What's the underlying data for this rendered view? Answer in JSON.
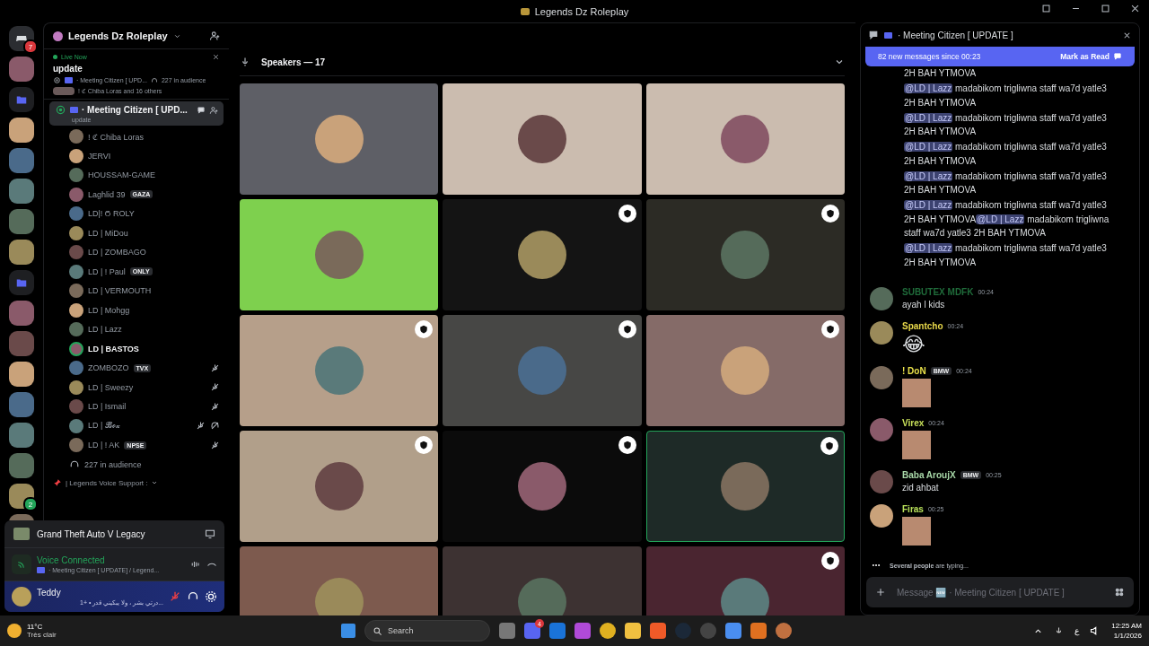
{
  "title_bar": {
    "title": "Legends Dz Roleplay"
  },
  "server_rail": [
    {
      "kind": "home",
      "badge": "7"
    },
    {
      "kind": "server"
    },
    {
      "kind": "folder"
    },
    {
      "kind": "server"
    },
    {
      "kind": "server"
    },
    {
      "kind": "server"
    },
    {
      "kind": "server"
    },
    {
      "kind": "server"
    },
    {
      "kind": "folder"
    },
    {
      "kind": "server"
    },
    {
      "kind": "server"
    },
    {
      "kind": "server"
    },
    {
      "kind": "server"
    },
    {
      "kind": "server"
    },
    {
      "kind": "server"
    },
    {
      "kind": "server",
      "badge": "2"
    },
    {
      "kind": "server"
    }
  ],
  "sidebar": {
    "server_name": "Legends Dz Roleplay",
    "live_card": {
      "status": "Live Now",
      "topic": "update",
      "channel": "· Meeting Citizen [ UPD...",
      "audience": "227 in audience",
      "speakers": "! ℭ Chiba Loras and 16 others"
    },
    "active_channel": {
      "name": "· Meeting Citizen [ UPD...",
      "topic": "update",
      "selected": true
    },
    "members": [
      {
        "name": "! ℭ Chiba Loras",
        "muted": false,
        "deafened": false,
        "speaking": false
      },
      {
        "name": "JERVI",
        "muted": false,
        "deafened": false,
        "speaking": false
      },
      {
        "name": "HOUSSAM-GAME",
        "muted": false,
        "deafened": false,
        "speaking": false
      },
      {
        "name": "Laghlid 39",
        "tag": "GAZA",
        "muted": false,
        "deafened": false,
        "speaking": false
      },
      {
        "name": "LD|! Ϭ ROLY",
        "muted": false,
        "deafened": false,
        "speaking": false
      },
      {
        "name": "LD | MiDou",
        "muted": false,
        "deafened": false,
        "speaking": false
      },
      {
        "name": "LD | ZOMBAGO",
        "muted": false,
        "deafened": false,
        "speaking": false
      },
      {
        "name": "LD | ! Paul",
        "tag": "ONLY",
        "muted": false,
        "deafened": false,
        "speaking": false
      },
      {
        "name": "LD | VERMOUTH",
        "muted": false,
        "deafened": false,
        "speaking": false
      },
      {
        "name": "LD | Mohgg",
        "muted": false,
        "deafened": false,
        "speaking": false
      },
      {
        "name": "LD | Lazz",
        "muted": false,
        "deafened": false,
        "speaking": false
      },
      {
        "name": "LD | BASTOS",
        "muted": false,
        "deafened": false,
        "speaking": true
      },
      {
        "name": "ZOMBOZO",
        "tag": "TVX",
        "muted": true,
        "deafened": false,
        "speaking": false
      },
      {
        "name": "LD |  Sweezy",
        "muted": true,
        "deafened": false,
        "speaking": false
      },
      {
        "name": "LD | Ismail",
        "muted": true,
        "deafened": false,
        "speaking": false
      },
      {
        "name": "LD | 𝓑𝓸𝔁",
        "muted": true,
        "deafened": true,
        "speaking": false
      },
      {
        "name": "LD | ! AK",
        "tag": "NPSE",
        "muted": true,
        "deafened": false,
        "speaking": false
      }
    ],
    "audience": "227 in audience",
    "category": "| Legends Voice Support :",
    "activity": "Grand Theft Auto V Legacy",
    "voice": {
      "status": "Voice Connected",
      "channel": "· Meeting Citizen [ UPDATE] / Legend..."
    },
    "user": {
      "name": "Teddy",
      "status": "...درتي بشر ، ولا يبكيني قدر • +1",
      "mic_muted": true
    }
  },
  "stage": {
    "heading": "Speakers — 17",
    "tiles": [
      {
        "color": "#5e5f66",
        "badge": false,
        "speaking": false
      },
      {
        "color": "#cbbcaf",
        "badge": false,
        "speaking": false
      },
      {
        "color": "#cbbcaf",
        "badge": false,
        "speaking": false
      },
      {
        "color": "#7ed04e",
        "badge": false,
        "speaking": false
      },
      {
        "color": "#141414",
        "badge": true,
        "speaking": false
      },
      {
        "color": "#2c2b25",
        "badge": true,
        "speaking": false
      },
      {
        "color": "#b69f8a",
        "badge": true,
        "speaking": false
      },
      {
        "color": "#474745",
        "badge": true,
        "speaking": false
      },
      {
        "color": "#856b68",
        "badge": true,
        "speaking": false
      },
      {
        "color": "#b19f8a",
        "badge": true,
        "speaking": false
      },
      {
        "color": "#0b0b0b",
        "badge": true,
        "speaking": false
      },
      {
        "color": "#1e2a27",
        "badge": true,
        "speaking": true
      },
      {
        "color": "#7d5a4e",
        "badge": false,
        "speaking": false
      },
      {
        "color": "#3d3232",
        "badge": false,
        "speaking": false
      },
      {
        "color": "#4a2530",
        "badge": true,
        "speaking": false
      }
    ]
  },
  "chat": {
    "title": "· Meeting Citizen [ UPDATE ]",
    "banner": {
      "text": "82 new messages since 00:23",
      "action": "Mark as Read"
    },
    "continued": [
      {
        "parts": [
          {
            "kind": "text",
            "text": "2H BAH YTMOVA"
          }
        ]
      },
      {
        "parts": [
          {
            "kind": "mention",
            "text": "@LD | Lazz"
          },
          {
            "kind": "text",
            "text": " madabikom trigliwna staff wa7d yatle3 2H BAH YTMOVA"
          }
        ]
      },
      {
        "parts": [
          {
            "kind": "mention",
            "text": "@LD | Lazz"
          },
          {
            "kind": "text",
            "text": " madabikom trigliwna staff wa7d yatle3 2H BAH YTMOVA"
          }
        ]
      },
      {
        "parts": [
          {
            "kind": "mention",
            "text": "@LD | Lazz"
          },
          {
            "kind": "text",
            "text": " madabikom trigliwna staff wa7d yatle3 2H BAH YTMOVA"
          }
        ]
      },
      {
        "parts": [
          {
            "kind": "mention",
            "text": "@LD | Lazz"
          },
          {
            "kind": "text",
            "text": " madabikom trigliwna staff wa7d yatle3 2H BAH YTMOVA"
          }
        ]
      },
      {
        "parts": [
          {
            "kind": "mention",
            "text": "@LD | Lazz"
          },
          {
            "kind": "text",
            "text": " madabikom trigliwna staff wa7d yatle3 2H BAH YTMOVA"
          },
          {
            "kind": "mention",
            "text": "@LD | Lazz"
          },
          {
            "kind": "text",
            "text": " madabikom trigliwna staff wa7d yatle3 2H BAH YTMOVA"
          }
        ]
      },
      {
        "parts": [
          {
            "kind": "mention",
            "text": "@LD | Lazz"
          },
          {
            "kind": "text",
            "text": " madabikom trigliwna staff wa7d yatle3 2H BAH YTMOVA"
          }
        ]
      }
    ],
    "messages": [
      {
        "author": "SUBUTEX MDFK",
        "color": "#1f6b3a",
        "time": "00:24",
        "kind": "text",
        "text": "ayah l kids"
      },
      {
        "author": "Spantcho",
        "color": "#e8d84a",
        "time": "00:24",
        "kind": "emoji",
        "text": "😂"
      },
      {
        "author": "! DoN",
        "color": "#e8e04a",
        "tag": "BMW",
        "time": "00:24",
        "kind": "image"
      },
      {
        "author": "Virex",
        "color": "#c8e05a",
        "time": "00:24",
        "kind": "image"
      },
      {
        "author": "Baba AroujX",
        "color": "#a8d8a8",
        "tag": "BMW",
        "time": "00:25",
        "kind": "text",
        "text": "zid ahbat"
      },
      {
        "author": "Firas",
        "color": "#b8e05a",
        "time": "00:25",
        "kind": "image"
      }
    ],
    "typing": "**Several people** are typing...",
    "composer": {
      "placeholder": "Message 🆕 · Meeting Citizen [ UPDATE ]"
    }
  },
  "taskbar": {
    "temperature": "11°C",
    "weather": "Très clair",
    "search": "Search",
    "discord_badge": "4",
    "time": "12:25 AM",
    "date": "1/1/2026",
    "lang": "ع"
  }
}
